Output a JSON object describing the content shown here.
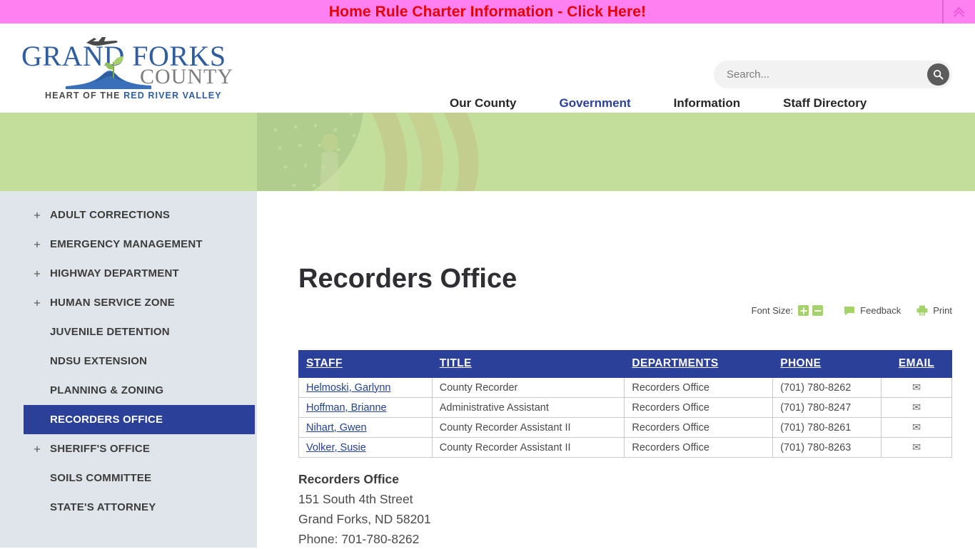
{
  "alert": {
    "text": "Home Rule Charter Information - Click Here!",
    "collapse_icon": "chevron-double-up-icon",
    "bg_color": "#ff80f0",
    "text_color": "#e60000"
  },
  "logo": {
    "line1": "GRAND FORKS",
    "line2": "COUNTY",
    "tagline_prefix": "HEART OF THE ",
    "tagline_highlight": "RED RIVER VALLEY",
    "plane_icon": "airplane-icon",
    "sprout_icon": "sprout-icon",
    "river_icon": "river-icon"
  },
  "search": {
    "placeholder": "Search...",
    "value": "",
    "button_icon": "search-icon"
  },
  "nav": {
    "items": [
      {
        "label": "Our County",
        "active": false
      },
      {
        "label": "Government",
        "active": true
      },
      {
        "label": "Information",
        "active": false
      },
      {
        "label": "Staff Directory",
        "active": false
      }
    ],
    "active_color": "#2b4099",
    "underline_color": "#a8cf6e"
  },
  "banner": {
    "bg_color": "#c3dd9b",
    "image": "american-flag-banner"
  },
  "sidebar": {
    "bg_color": "#dfe5ea",
    "active_color": "#2b4099",
    "items": [
      {
        "label": "ADULT CORRECTIONS",
        "expandable": true,
        "active": false
      },
      {
        "label": "EMERGENCY MANAGEMENT",
        "expandable": true,
        "active": false
      },
      {
        "label": "HIGHWAY DEPARTMENT",
        "expandable": true,
        "active": false
      },
      {
        "label": "HUMAN SERVICE ZONE",
        "expandable": true,
        "active": false
      },
      {
        "label": "JUVENILE DETENTION",
        "expandable": false,
        "active": false
      },
      {
        "label": "NDSU EXTENSION",
        "expandable": false,
        "active": false
      },
      {
        "label": "PLANNING & ZONING",
        "expandable": false,
        "active": false
      },
      {
        "label": "RECORDERS OFFICE",
        "expandable": false,
        "active": true
      },
      {
        "label": "SHERIFF'S OFFICE",
        "expandable": true,
        "active": false
      },
      {
        "label": "SOILS COMMITTEE",
        "expandable": false,
        "active": false
      },
      {
        "label": "STATE'S ATTORNEY",
        "expandable": false,
        "active": false
      }
    ],
    "expand_symbol": "+"
  },
  "main": {
    "title": "Recorders Office",
    "utility": {
      "font_size_label": "Font Size:",
      "increase_label": "+",
      "decrease_label": "−",
      "feedback_label": "Feedback",
      "print_label": "Print",
      "accent_color": "#a5d26a"
    },
    "table": {
      "columns": [
        "STAFF",
        "TITLE",
        "DEPARTMENTS",
        "PHONE",
        "EMAIL"
      ],
      "header_bg": "#2b4099",
      "email_icon": "envelope-icon",
      "rows": [
        {
          "staff": "Helmoski, Garlynn",
          "title": "County Recorder",
          "department": "Recorders Office",
          "phone": "(701) 780-8262"
        },
        {
          "staff": "Hoffman, Brianne",
          "title": "Administrative Assistant",
          "department": "Recorders Office",
          "phone": "(701) 780-8247"
        },
        {
          "staff": "Nihart, Gwen",
          "title": "County Recorder Assistant II",
          "department": "Recorders Office",
          "phone": "(701) 780-8261"
        },
        {
          "staff": "Volker, Susie",
          "title": "County Recorder Assistant II",
          "department": "Recorders Office",
          "phone": "(701) 780-8263"
        }
      ]
    },
    "address": {
      "name": "Recorders Office",
      "street": "151 South 4th Street",
      "city_state_zip": "Grand Forks, ND 58201",
      "phone": "Phone: 701-780-8262"
    }
  }
}
